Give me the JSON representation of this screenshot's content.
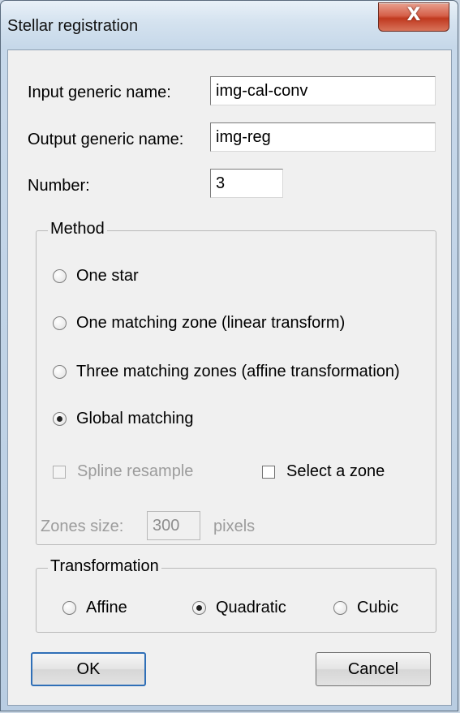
{
  "window": {
    "title": "Stellar registration",
    "close_icon": "close-x-icon",
    "close_glyph": "X"
  },
  "fields": {
    "input_label": "Input generic name:",
    "input_value": "img-cal-conv",
    "output_label": "Output generic name:",
    "output_value": "img-reg",
    "number_label": "Number:",
    "number_value": "3"
  },
  "method": {
    "legend": "Method",
    "options": [
      {
        "label": "One star",
        "checked": false
      },
      {
        "label": "One matching zone (linear transform)",
        "checked": false
      },
      {
        "label": "Three matching zones (affine transformation)",
        "checked": false
      },
      {
        "label": "Global matching",
        "checked": true
      }
    ],
    "spline_label": "Spline resample",
    "spline_checked": false,
    "spline_disabled": true,
    "select_zone_label": "Select a zone",
    "select_zone_checked": false,
    "zones_size_label": "Zones size:",
    "zones_size_value": "300",
    "zones_unit": "pixels"
  },
  "transformation": {
    "legend": "Transformation",
    "options": [
      {
        "label": "Affine",
        "checked": false
      },
      {
        "label": "Quadratic",
        "checked": true
      },
      {
        "label": "Cubic",
        "checked": false
      }
    ]
  },
  "buttons": {
    "ok": "OK",
    "cancel": "Cancel"
  },
  "colors": {
    "title_bar": "#c5d7e9",
    "close_button": "#c0391f",
    "dialog_bg": "#f0f0f0",
    "disabled_text": "#9c9c9c",
    "default_button_border": "#2f6fb7"
  }
}
